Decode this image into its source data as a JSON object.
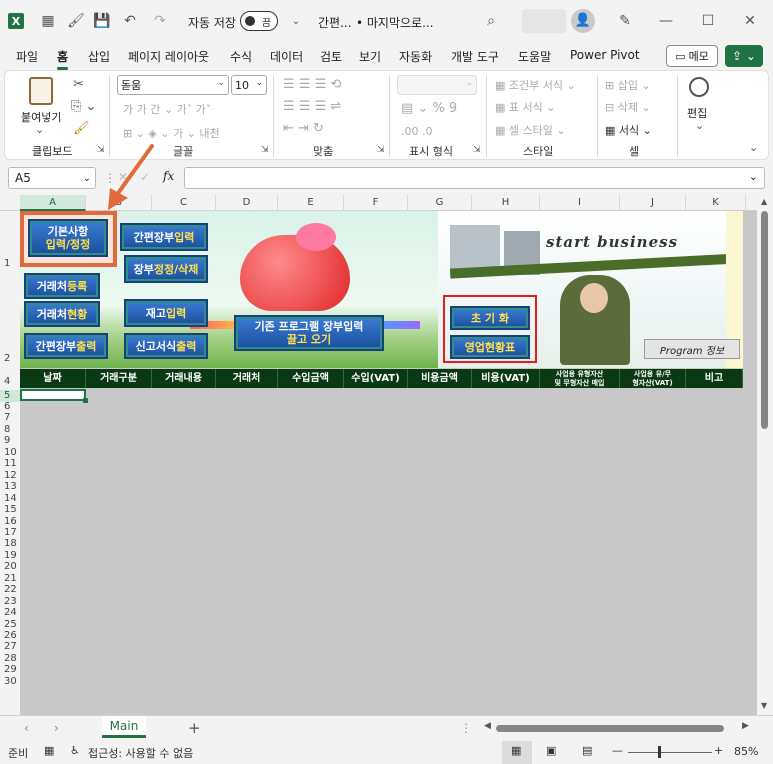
{
  "titlebar": {
    "autosave_label": "자동 저장",
    "autosave_state": "끔",
    "filename": "간편...",
    "location": "• 마지막으로...",
    "window_minimize": "—",
    "window_restore": "☐",
    "window_close": "✕"
  },
  "menu": {
    "tabs": [
      "파일",
      "홈",
      "삽입",
      "페이지 레이아웃",
      "수식",
      "데이터",
      "검토",
      "보기",
      "자동화",
      "개발 도구",
      "도움말",
      "Power Pivot"
    ],
    "active": "홈",
    "memo_label": "메모",
    "share_icon": "share-icon"
  },
  "ribbon": {
    "clipboard": {
      "paste_label": "붙여넣기",
      "group_label": "클립보드"
    },
    "font": {
      "font_name": "돋움",
      "font_size": "10",
      "group_label": "글꼴"
    },
    "align": {
      "group_label": "맞춤"
    },
    "number": {
      "group_label": "표시 형식"
    },
    "style": {
      "conditional": "조건부 서식",
      "table": "표 서식",
      "cell": "셀 스타일",
      "group_label": "스타일"
    },
    "cells": {
      "insert": "삽입",
      "delete": "삭제",
      "format": "서식",
      "group_label": "셀"
    },
    "edit": {
      "label": "편집"
    }
  },
  "formula_bar": {
    "name_box": "A5",
    "fx": "fx",
    "value": ""
  },
  "columns": [
    "A",
    "B",
    "C",
    "D",
    "E",
    "F",
    "G",
    "H",
    "I",
    "J",
    "K"
  ],
  "selected_column": "A",
  "rows": [
    "1",
    "2",
    "4",
    "5",
    "6",
    "7",
    "8",
    "9",
    "10",
    "11",
    "12",
    "13",
    "14",
    "15",
    "16",
    "17",
    "18",
    "19",
    "20",
    "21",
    "22",
    "23",
    "24",
    "25",
    "26",
    "27",
    "28",
    "29",
    "30"
  ],
  "selected_row": "5",
  "sheet_buttons": {
    "basic_info": {
      "l1": "기본사항",
      "l2": "입력/정정"
    },
    "simple_ledger_input": {
      "a": "간편장부 ",
      "b": "입력"
    },
    "ledger_edit": {
      "a": "장부 ",
      "b": "정정/삭제"
    },
    "partner_reg": {
      "a": "거래처 ",
      "b": "등록"
    },
    "partner_status": {
      "a": "거래처 ",
      "b": "현황"
    },
    "stock_input": {
      "a": "재고 ",
      "b": "입력"
    },
    "simple_ledger_print": {
      "a": "간편장부 ",
      "b": "출력"
    },
    "report_print": {
      "a": "신고서식 ",
      "b": "출력"
    },
    "import_ledger": {
      "l1": "기존 프로그램 장부입력",
      "l2": "끌고 오기"
    },
    "reset": "초 기 화",
    "business_status": "영업현황표",
    "program_info": "Program 정보"
  },
  "banner_text": "start business",
  "header_cells": [
    "날짜",
    "거래구분",
    "거래내용",
    "거래처",
    "수입금액",
    "수입(VAT)",
    "비용금액",
    "비용(VAT)",
    "사업용 유형자산\n및 무형자산 매입",
    "사업용 유/무\n형자산(VAT)",
    "비고"
  ],
  "sheet_tabs": {
    "active": "Main",
    "add": "+"
  },
  "status": {
    "ready": "준비",
    "accessibility": "접근성: 사용할 수 없음",
    "zoom": "85%"
  },
  "colors": {
    "excel_green": "#217346",
    "header_bg": "#0a3a14",
    "button_blue": "#1c4f9c",
    "highlight_red": "#e02020",
    "arrow": "#e06a3c"
  }
}
